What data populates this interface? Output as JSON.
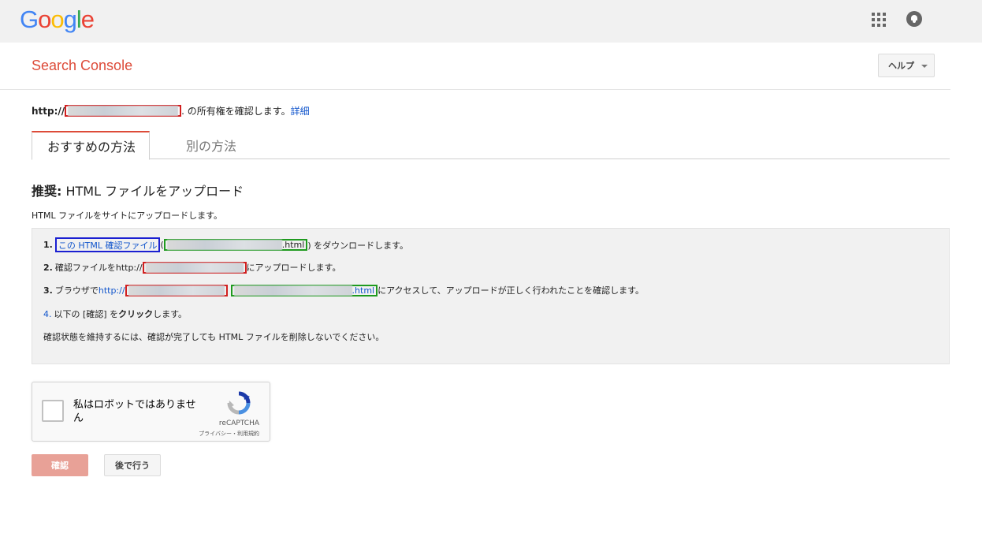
{
  "topbar": {
    "logo_letters": [
      {
        "ch": "G",
        "color": "#4285f4"
      },
      {
        "ch": "o",
        "color": "#ea4335"
      },
      {
        "ch": "o",
        "color": "#fbbc05"
      },
      {
        "ch": "g",
        "color": "#4285f4"
      },
      {
        "ch": "l",
        "color": "#34a853"
      },
      {
        "ch": "e",
        "color": "#ea4335"
      }
    ],
    "apps_icon": "apps-grid-icon",
    "notification_icon": "bell-icon"
  },
  "header": {
    "brand": "Search Console",
    "brand_color": "#dd4b39",
    "help_label": "ヘルプ"
  },
  "ownership": {
    "protocol": "http://",
    "suffix": ". の所有権を確認します。",
    "details_link": "詳細"
  },
  "tabs": [
    {
      "label": "おすすめの方法",
      "active": true
    },
    {
      "label": "別の方法",
      "active": false
    }
  ],
  "recommend": {
    "prefix": "推奨:",
    "title": " HTML ファイルをアップロード",
    "intro": "HTML ファイルをサイトにアップロードします。"
  },
  "steps": {
    "s1_num": "1.",
    "s1_link": "この HTML 確認ファイル",
    "s1_paren_open": " (",
    "s1_file_ext": ".html",
    "s1_suffix": ") をダウンロードします。",
    "s2_num": "2.",
    "s2_text": "確認ファイルを ",
    "s2_proto": "http://",
    "s2_suffix": " にアップロードします。",
    "s3_num": "3.",
    "s3_text": "ブラウザで ",
    "s3_proto": "http://",
    "s3_file_ext": ".html",
    "s3_suffix": "にアクセスして、アップロードが正しく行われたことを確認します。",
    "s4_num": "4.",
    "s4_text": " 以下の [確認] を",
    "s4_bold": "クリック",
    "s4_suffix": "します。",
    "note": "確認状態を維持するには、確認が完了しても HTML ファイルを削除しないでください。"
  },
  "captcha": {
    "label": "私はロボットではありません",
    "brand": "reCAPTCHA",
    "links": "プライバシー・利用規約"
  },
  "buttons": {
    "confirm": "確認",
    "later": "後で行う"
  }
}
